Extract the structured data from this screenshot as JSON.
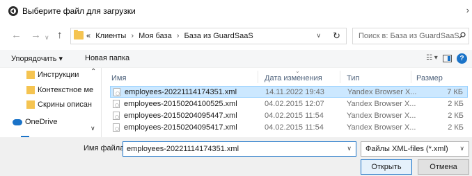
{
  "window": {
    "title": "Выберите файл для загрузки",
    "close_glyph": "›"
  },
  "nav": {
    "back_icon": "arrow-left-icon",
    "forward_icon": "arrow-right-icon",
    "up_icon": "arrow-up-icon"
  },
  "address": {
    "overflow": "«",
    "crumbs": [
      "Клиенты",
      "Моя база",
      "База из GuardSaaS"
    ],
    "separator": "›"
  },
  "search": {
    "placeholder": "Поиск в: База из GuardSaaS"
  },
  "toolbar": {
    "organize": "Упорядочить ▾",
    "new_folder": "Новая папка",
    "help": "?"
  },
  "sidebar": {
    "items": [
      {
        "label": "Инструкции"
      },
      {
        "label": "Контекстное ме"
      },
      {
        "label": "Скрины описан"
      }
    ],
    "onedrive": "OneDrive"
  },
  "columns": {
    "name": "Имя",
    "date": "Дата изменения",
    "type": "Тип",
    "size": "Размер"
  },
  "files": [
    {
      "name": "employees-20221114174351.xml",
      "date": "14.11.2022 19:43",
      "type": "Yandex Browser X...",
      "size": "7 КБ",
      "selected": true
    },
    {
      "name": "employees-20150204100525.xml",
      "date": "04.02.2015 12:07",
      "type": "Yandex Browser X...",
      "size": "2 КБ",
      "selected": false
    },
    {
      "name": "employees-20150204095447.xml",
      "date": "04.02.2015 11:54",
      "type": "Yandex Browser X...",
      "size": "2 КБ",
      "selected": false
    },
    {
      "name": "employees-20150204095417.xml",
      "date": "04.02.2015 11:54",
      "type": "Yandex Browser X...",
      "size": "2 КБ",
      "selected": false
    }
  ],
  "footer": {
    "filename_label": "Имя файла:",
    "filename_value": "employees-20221114174351.xml",
    "filetype_value": "Файлы XML-files (*.xml)",
    "open_button": "Открыть",
    "cancel_button": "Отмена"
  },
  "colors": {
    "accent": "#1a73c8",
    "selection_bg": "#cce8ff",
    "selection_border": "#99d1ff",
    "folder": "#f5c451"
  }
}
